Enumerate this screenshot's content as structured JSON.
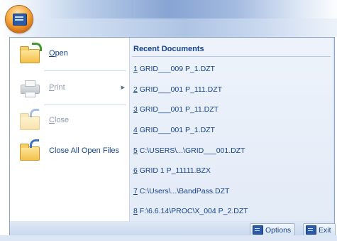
{
  "menu": {
    "commands": [
      {
        "name": "open",
        "mnemonic": "O",
        "rest": "pen",
        "enabled": true,
        "icon": "open-folder-icon"
      },
      {
        "name": "print",
        "mnemonic": "P",
        "rest": "rint",
        "enabled": false,
        "icon": "printer-icon",
        "submenu": true
      },
      {
        "name": "close",
        "mnemonic": "C",
        "rest": "lose",
        "enabled": false,
        "icon": "close-folder-icon"
      },
      {
        "name": "close-all",
        "label": "Close All Open Files",
        "enabled": true,
        "icon": "close-all-folder-icon"
      }
    ]
  },
  "recent": {
    "header": "Recent Documents",
    "items": [
      {
        "num": "1",
        "text": " GRID___009 P_1.DZT"
      },
      {
        "num": "2",
        "text": " GRID___001 P_111.DZT"
      },
      {
        "num": "3",
        "text": " GRID___001 P_11.DZT"
      },
      {
        "num": "4",
        "text": " GRID___001 P_1.DZT"
      },
      {
        "num": "5",
        "text": " C:\\USERS\\...\\GRID___001.DZT"
      },
      {
        "num": "6",
        "text": " GRID 1 P_11111.BZX"
      },
      {
        "num": "7",
        "text": " C:\\Users\\...\\BandPass.DZT"
      },
      {
        "num": "8",
        "text": " F:\\6.6.14\\PROC\\X_004 P_2.DZT"
      }
    ]
  },
  "footer": {
    "options_label": "Options",
    "exit_label": "Exit"
  },
  "colors": {
    "accent_text": "#15428b",
    "disabled_text": "#8d9bb0",
    "app_orb": "#f6a93b"
  }
}
